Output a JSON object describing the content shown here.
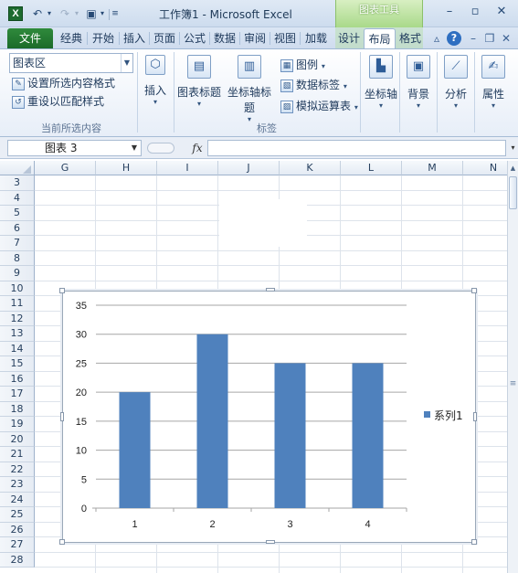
{
  "titlebar": {
    "app_letter": "X",
    "title": "工作簿1 - Microsoft Excel",
    "context_group": "图表工具"
  },
  "ribbon_tabs": {
    "file": "文件",
    "items": [
      "经典",
      "开始",
      "插入",
      "页面",
      "公式",
      "数据",
      "审阅",
      "视图",
      "加载"
    ],
    "context_tabs": [
      "设计",
      "布局",
      "格式"
    ],
    "active": "布局"
  },
  "ribbon": {
    "selection_combo": "图表区",
    "format_selection": "设置所选内容格式",
    "reset_style": "重设以匹配样式",
    "group_current_selection": "当前所选内容",
    "insert": "插入",
    "chart_title": "图表标题",
    "axis_titles": "坐标轴标题",
    "legend": "图例",
    "data_labels": "数据标签",
    "data_table": "模拟运算表",
    "group_labels": "标签",
    "axes": "坐标轴",
    "background": "背景",
    "analysis": "分析",
    "properties": "属性"
  },
  "formula_bar": {
    "name_box": "图表 3",
    "fx": "fx",
    "formula": ""
  },
  "sheet": {
    "columns": [
      "G",
      "H",
      "I",
      "J",
      "K",
      "L",
      "M",
      "N"
    ],
    "rows": [
      "3",
      "4",
      "5",
      "6",
      "7",
      "8",
      "9",
      "10",
      "11",
      "12",
      "13",
      "14",
      "15",
      "16",
      "17",
      "18",
      "19",
      "20",
      "21",
      "22",
      "23",
      "24",
      "25",
      "26",
      "27",
      "28"
    ]
  },
  "chart_data": {
    "type": "bar",
    "categories": [
      "1",
      "2",
      "3",
      "4"
    ],
    "series": [
      {
        "name": "系列1",
        "values": [
          20,
          30,
          25,
          25
        ]
      }
    ],
    "yticks": [
      "0",
      "5",
      "10",
      "15",
      "20",
      "25",
      "30",
      "35"
    ],
    "ylim": [
      0,
      35
    ],
    "title": "",
    "xlabel": "",
    "ylabel": "",
    "grid": true,
    "legend_position": "right",
    "bar_color": "#4f81bd",
    "gridline_color": "#a6a6a6"
  }
}
